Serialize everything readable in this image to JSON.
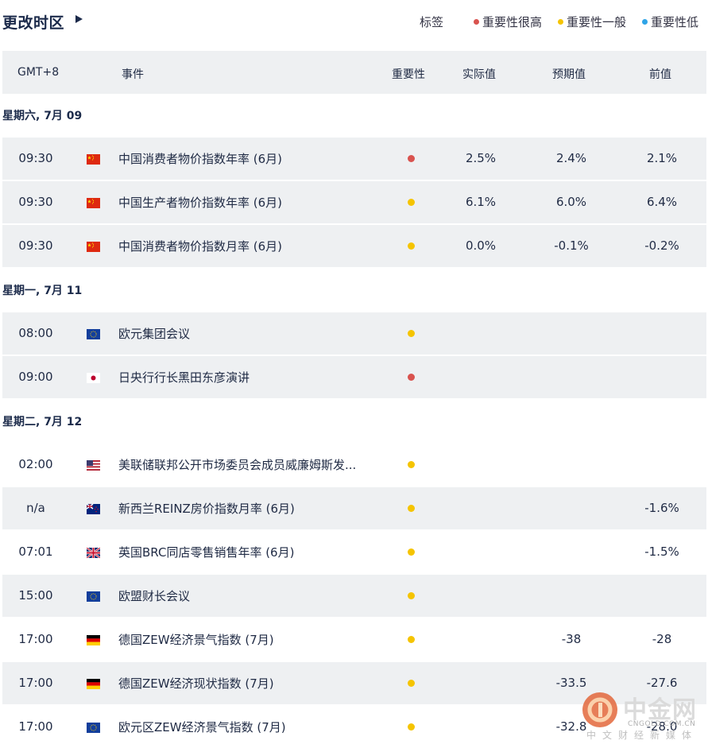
{
  "topbar": {
    "timezone_label": "更改时区",
    "legend_label": "标签",
    "legend": [
      {
        "label": "重要性很高",
        "color": "#d9534f"
      },
      {
        "label": "重要性一般",
        "color": "#f5c400"
      },
      {
        "label": "重要性低",
        "color": "#2fa4e7"
      }
    ]
  },
  "header": {
    "gmt": "GMT+8",
    "event": "事件",
    "importance": "重要性",
    "actual": "实际值",
    "forecast": "预期值",
    "previous": "前值"
  },
  "days": [
    {
      "label": "星期六, 7月 09",
      "rows": [
        {
          "time": "09:30",
          "flag": "cn",
          "event": "中国消费者物价指数年率 (6月)",
          "importance": "high",
          "actual": "2.5%",
          "forecast": "2.4%",
          "previous": "2.1%"
        },
        {
          "time": "09:30",
          "flag": "cn",
          "event": "中国生产者物价指数年率 (6月)",
          "importance": "medium",
          "actual": "6.1%",
          "forecast": "6.0%",
          "previous": "6.4%"
        },
        {
          "time": "09:30",
          "flag": "cn",
          "event": "中国消费者物价指数月率 (6月)",
          "importance": "medium",
          "actual": "0.0%",
          "forecast": "-0.1%",
          "previous": "-0.2%"
        }
      ]
    },
    {
      "label": "星期一, 7月 11",
      "rows": [
        {
          "time": "08:00",
          "flag": "eu",
          "event": "欧元集团会议",
          "importance": "medium",
          "actual": "",
          "forecast": "",
          "previous": ""
        },
        {
          "time": "09:00",
          "flag": "jp",
          "event": "日央行行长黑田东彦演讲",
          "importance": "high",
          "actual": "",
          "forecast": "",
          "previous": ""
        }
      ]
    },
    {
      "label": "星期二, 7月 12",
      "rows": [
        {
          "time": "02:00",
          "flag": "us",
          "event": "美联储联邦公开市场委员会成员威廉姆斯发...",
          "importance": "medium",
          "actual": "",
          "forecast": "",
          "previous": ""
        },
        {
          "time": "n/a",
          "flag": "nz",
          "event": "新西兰REINZ房价指数月率 (6月)",
          "importance": "medium",
          "actual": "",
          "forecast": "",
          "previous": "-1.6%"
        },
        {
          "time": "07:01",
          "flag": "gb",
          "event": "英国BRC同店零售销售年率 (6月)",
          "importance": "medium",
          "actual": "",
          "forecast": "",
          "previous": "-1.5%"
        },
        {
          "time": "15:00",
          "flag": "eu",
          "event": "欧盟财长会议",
          "importance": "medium",
          "actual": "",
          "forecast": "",
          "previous": ""
        },
        {
          "time": "17:00",
          "flag": "de",
          "event": "德国ZEW经济景气指数 (7月)",
          "importance": "medium",
          "actual": "",
          "forecast": "-38",
          "previous": "-28"
        },
        {
          "time": "17:00",
          "flag": "de",
          "event": "德国ZEW经济现状指数 (7月)",
          "importance": "medium",
          "actual": "",
          "forecast": "-33.5",
          "previous": "-27.6"
        },
        {
          "time": "17:00",
          "flag": "eu",
          "event": "欧元区ZEW经济景气指数 (7月)",
          "importance": "medium",
          "actual": "",
          "forecast": "-32.8",
          "previous": "-28.0"
        }
      ]
    }
  ],
  "importance_colors": {
    "high": "#d9534f",
    "medium": "#f5c400",
    "low": "#2fa4e7"
  },
  "watermark": {
    "title": "中金网",
    "domain": "CNGOLD.COM.CN",
    "subtitle": "中文财经新媒体"
  }
}
